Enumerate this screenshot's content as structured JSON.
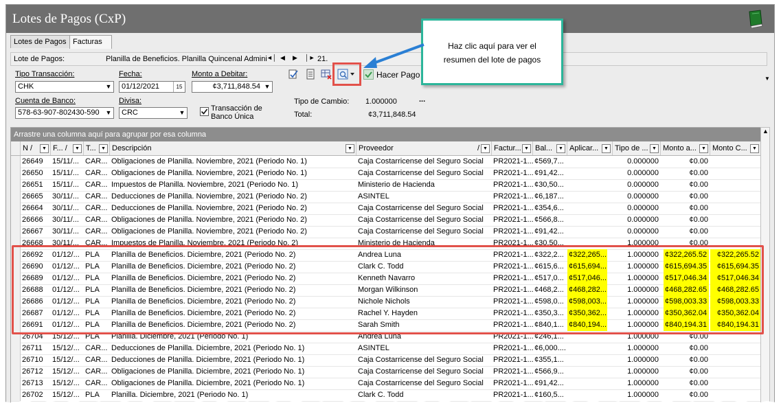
{
  "window": {
    "title": "Lotes de Pagos (CxP)"
  },
  "tabs": [
    {
      "label": "Lotes de Pagos"
    },
    {
      "label": "Facturas"
    }
  ],
  "lote": {
    "label": "Lote de Pagos:",
    "value": "Planilla de Beneficios.  Planilla Quincenal Admini",
    "record_num": "21."
  },
  "form": {
    "tipo_transaccion_label": "Tipo Transacción:",
    "tipo_transaccion_value": "CHK",
    "fecha_label": "Fecha:",
    "fecha_value": "01/12/2021",
    "fecha_btn": "15",
    "monto_label": "Monto a Debitar:",
    "monto_value": "¢3,711,848.54",
    "hacer_pago_label": "Hacer Pago",
    "cuenta_label": "Cuenta de Banco:",
    "cuenta_value": "578-63-907-802430-590",
    "divisa_label": "Divisa:",
    "divisa_value": "CRC",
    "transaccion_label_1": "Transacción de",
    "transaccion_label_2": "Banco Única",
    "tipo_cambio_label": "Tipo de Cambio:",
    "tipo_cambio_value": "1.000000",
    "tipo_cambio_more": "...",
    "total_label": "Total:",
    "total_value": "¢3,711,848.54"
  },
  "callout": {
    "line1": "Haz clic aquí para ver el",
    "line2": "resumen del lote de pagos"
  },
  "grid": {
    "group_hint": "Arrastre una columna aquí para agrupar por esa columna",
    "columns": [
      "N /",
      "F... /",
      "T...",
      "Descripción",
      "Proveedor",
      "Factur...",
      "Bal...",
      "Aplicar...",
      "Tipo de ...",
      "Monto a...",
      "Monto C..."
    ],
    "rows": [
      [
        "26649",
        "15/11/...",
        "CAR...",
        "Obligaciones de Planilla. Noviembre, 2021 (Periodo No. 1)",
        "Caja Costarricense del Seguro Social",
        "PR2021-1...",
        "¢569,7...",
        "",
        "0.000000",
        "¢0.00",
        ""
      ],
      [
        "26650",
        "15/11/...",
        "CAR...",
        "Obligaciones de Planilla. Noviembre, 2021 (Periodo No. 1)",
        "Caja Costarricense del Seguro Social",
        "PR2021-1...",
        "¢91,42...",
        "",
        "0.000000",
        "¢0.00",
        ""
      ],
      [
        "26651",
        "15/11/...",
        "CAR...",
        "Impuestos de Planilla. Noviembre, 2021 (Periodo No. 1)",
        "Ministerio de Hacienda",
        "PR2021-1...",
        "¢30,50...",
        "",
        "0.000000",
        "¢0.00",
        ""
      ],
      [
        "26665",
        "30/11/...",
        "CAR...",
        "Deducciones de Planilla. Noviembre, 2021 (Periodo No. 2)",
        "ASINTEL",
        "PR2021-1...",
        "¢6,187...",
        "",
        "0.000000",
        "¢0.00",
        ""
      ],
      [
        "26664",
        "30/11/...",
        "CAR...",
        "Deducciones de Planilla. Noviembre, 2021 (Periodo No. 2)",
        "Caja Costarricense del Seguro Social",
        "PR2021-1...",
        "¢354,6...",
        "",
        "0.000000",
        "¢0.00",
        ""
      ],
      [
        "26666",
        "30/11/...",
        "CAR...",
        "Obligaciones de Planilla. Noviembre, 2021 (Periodo No. 2)",
        "Caja Costarricense del Seguro Social",
        "PR2021-1...",
        "¢566,8...",
        "",
        "0.000000",
        "¢0.00",
        ""
      ],
      [
        "26667",
        "30/11/...",
        "CAR...",
        "Obligaciones de Planilla. Noviembre, 2021 (Periodo No. 2)",
        "Caja Costarricense del Seguro Social",
        "PR2021-1...",
        "¢91,42...",
        "",
        "0.000000",
        "¢0.00",
        ""
      ],
      [
        "26668",
        "30/11/...",
        "CAR...",
        "Impuestos de Planilla. Noviembre, 2021 (Periodo No. 2)",
        "Ministerio de Hacienda",
        "PR2021-1...",
        "¢30,50...",
        "",
        "1.000000",
        "¢0.00",
        ""
      ],
      [
        "26692",
        "01/12/...",
        "PLA",
        "Planilla de Beneficios.  Diciembre, 2021 (Periodo No. 2)",
        "Andrea Luna",
        "PR2021-1...",
        "¢322,2...",
        "¢322,265....",
        "1.000000",
        "¢322,265.52",
        "¢322,265.52"
      ],
      [
        "26690",
        "01/12/...",
        "PLA",
        "Planilla de Beneficios.  Diciembre, 2021 (Periodo No. 2)",
        "Clark C. Todd",
        "PR2021-1...",
        "¢615,6...",
        "¢615,694....",
        "1.000000",
        "¢615,694.35",
        "¢615,694.35"
      ],
      [
        "26689",
        "01/12/...",
        "PLA",
        "Planilla de Beneficios.  Diciembre, 2021 (Periodo No. 2)",
        "Kenneth Navarro",
        "PR2021-1...",
        "¢517,0...",
        "¢517,046....",
        "1.000000",
        "¢517,046.34",
        "¢517,046.34"
      ],
      [
        "26688",
        "01/12/...",
        "PLA",
        "Planilla de Beneficios.  Diciembre, 2021 (Periodo No. 2)",
        "Morgan Wilkinson",
        "PR2021-1...",
        "¢468,2...",
        "¢468,282....",
        "1.000000",
        "¢468,282.65",
        "¢468,282.65"
      ],
      [
        "26686",
        "01/12/...",
        "PLA",
        "Planilla de Beneficios.  Diciembre, 2021 (Periodo No. 2)",
        "Nichole Nichols",
        "PR2021-1...",
        "¢598,0...",
        "¢598,003....",
        "1.000000",
        "¢598,003.33",
        "¢598,003.33"
      ],
      [
        "26687",
        "01/12/...",
        "PLA",
        "Planilla de Beneficios.  Diciembre, 2021 (Periodo No. 2)",
        "Rachel Y. Hayden",
        "PR2021-1...",
        "¢350,3...",
        "¢350,362....",
        "1.000000",
        "¢350,362.04",
        "¢350,362.04"
      ],
      [
        "26691",
        "01/12/...",
        "PLA",
        "Planilla de Beneficios.  Diciembre, 2021 (Periodo No. 2)",
        "Sarah Smith",
        "PR2021-1...",
        "¢840,1...",
        "¢840,194....",
        "1.000000",
        "¢840,194.31",
        "¢840,194.31"
      ],
      [
        "26704",
        "15/12/...",
        "PLA",
        "Planilla.  Diciembre, 2021 (Periodo No. 1)",
        "Andrea Luna",
        "PR2021-1...",
        "¢246,1...",
        "",
        "1.000000",
        "¢0.00",
        ""
      ],
      [
        "26711",
        "15/12/...",
        "CAR...",
        "Deducciones de Planilla. Diciembre, 2021 (Periodo No. 1)",
        "ASINTEL",
        "PR2021-1...",
        "¢6,000....",
        "",
        "1.000000",
        "¢0.00",
        ""
      ],
      [
        "26710",
        "15/12/...",
        "CAR...",
        "Deducciones de Planilla. Diciembre, 2021 (Periodo No. 1)",
        "Caja Costarricense del Seguro Social",
        "PR2021-1...",
        "¢355,1...",
        "",
        "1.000000",
        "¢0.00",
        ""
      ],
      [
        "26712",
        "15/12/...",
        "CAR...",
        "Obligaciones de Planilla. Diciembre, 2021 (Periodo No. 1)",
        "Caja Costarricense del Seguro Social",
        "PR2021-1...",
        "¢566,9...",
        "",
        "1.000000",
        "¢0.00",
        ""
      ],
      [
        "26713",
        "15/12/...",
        "CAR...",
        "Obligaciones de Planilla. Diciembre, 2021 (Periodo No. 1)",
        "Caja Costarricense del Seguro Social",
        "PR2021-1...",
        "¢91,42...",
        "",
        "1.000000",
        "¢0.00",
        ""
      ],
      [
        "26702",
        "15/12/...",
        "PLA",
        "Planilla.  Diciembre, 2021 (Periodo No. 1)",
        "Clark C. Todd",
        "PR2021-1...",
        "¢160,5...",
        "",
        "1.000000",
        "¢0.00",
        ""
      ]
    ]
  },
  "colors": {
    "titlebar": "#6f6f6f",
    "highlight_yellow": "#ffff00",
    "callout_border": "#2bb59a",
    "annotation_red": "#e2514a",
    "arrow_blue": "#2a7fd4"
  }
}
